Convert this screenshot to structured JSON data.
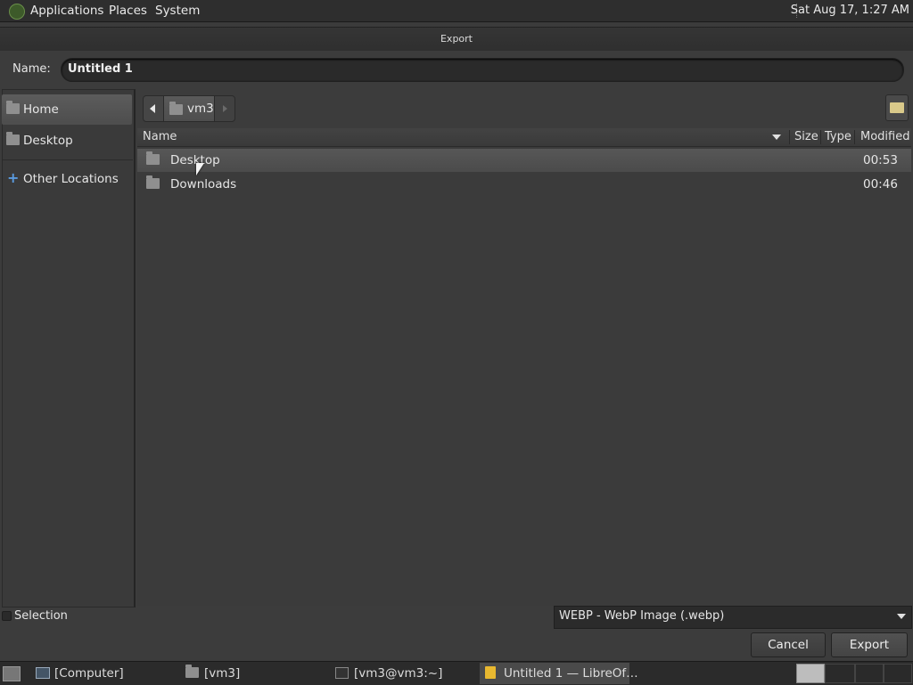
{
  "top_panel": {
    "menus": [
      "Applications",
      "Places",
      "System"
    ],
    "clock": "Sat Aug 17,  1:27 AM"
  },
  "dialog": {
    "title": "Export",
    "name_label": "Name:",
    "name_value": "Untitled 1",
    "sidebar": {
      "items": [
        {
          "label": "Home",
          "icon": "home-folder-icon"
        },
        {
          "label": "Desktop",
          "icon": "desktop-folder-icon"
        },
        {
          "label": "Other Locations",
          "icon": "plus-icon"
        }
      ]
    },
    "path": {
      "current": "vm3"
    },
    "columns": {
      "name": "Name",
      "size": "Size",
      "type": "Type",
      "modified": "Modified"
    },
    "files": [
      {
        "name": "Desktop",
        "modified": "00:53"
      },
      {
        "name": "Downloads",
        "modified": "00:46"
      }
    ],
    "selection_label": "Selection",
    "filetype": "WEBP - WebP Image (.webp)",
    "cancel_label": "Cancel",
    "export_label": "Export"
  },
  "taskbar": {
    "items": [
      {
        "label": "[Computer]",
        "icon": "computer-icon"
      },
      {
        "label": "[vm3]",
        "icon": "folder-icon"
      },
      {
        "label": "[vm3@vm3:~]",
        "icon": "terminal-icon"
      },
      {
        "label": "Untitled 1 — LibreOf…",
        "icon": "libreoffice-draw-icon"
      }
    ]
  }
}
